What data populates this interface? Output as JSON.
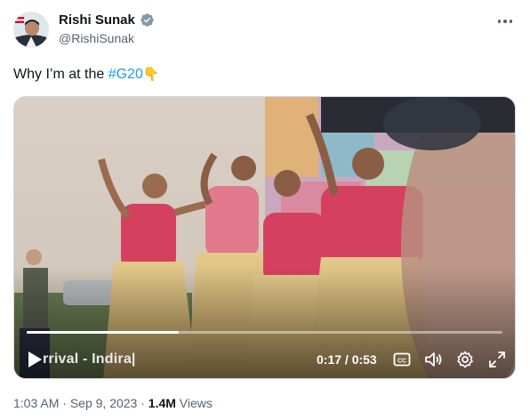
{
  "author": {
    "display_name": "Rishi Sunak",
    "handle": "@RishiSunak",
    "verified": true
  },
  "tweet": {
    "text_prefix": "Why I’m at the ",
    "hashtag": "#G20",
    "emoji": "👇"
  },
  "video": {
    "overlay_caption": "rrival - Indira|",
    "time_display": "0:17 / 0:53",
    "progress_fraction": 0.32,
    "controls": [
      "play-icon",
      "captions-icon",
      "volume-icon",
      "settings-icon",
      "fullscreen-icon"
    ]
  },
  "meta": {
    "time": "1:03 AM",
    "separator": " · ",
    "date": "Sep 9, 2023",
    "views_count": "1.4M",
    "views_label": " Views"
  },
  "colors": {
    "link": "#1d9bf0",
    "verified": "#829aab",
    "secondary_text": "#536471"
  }
}
